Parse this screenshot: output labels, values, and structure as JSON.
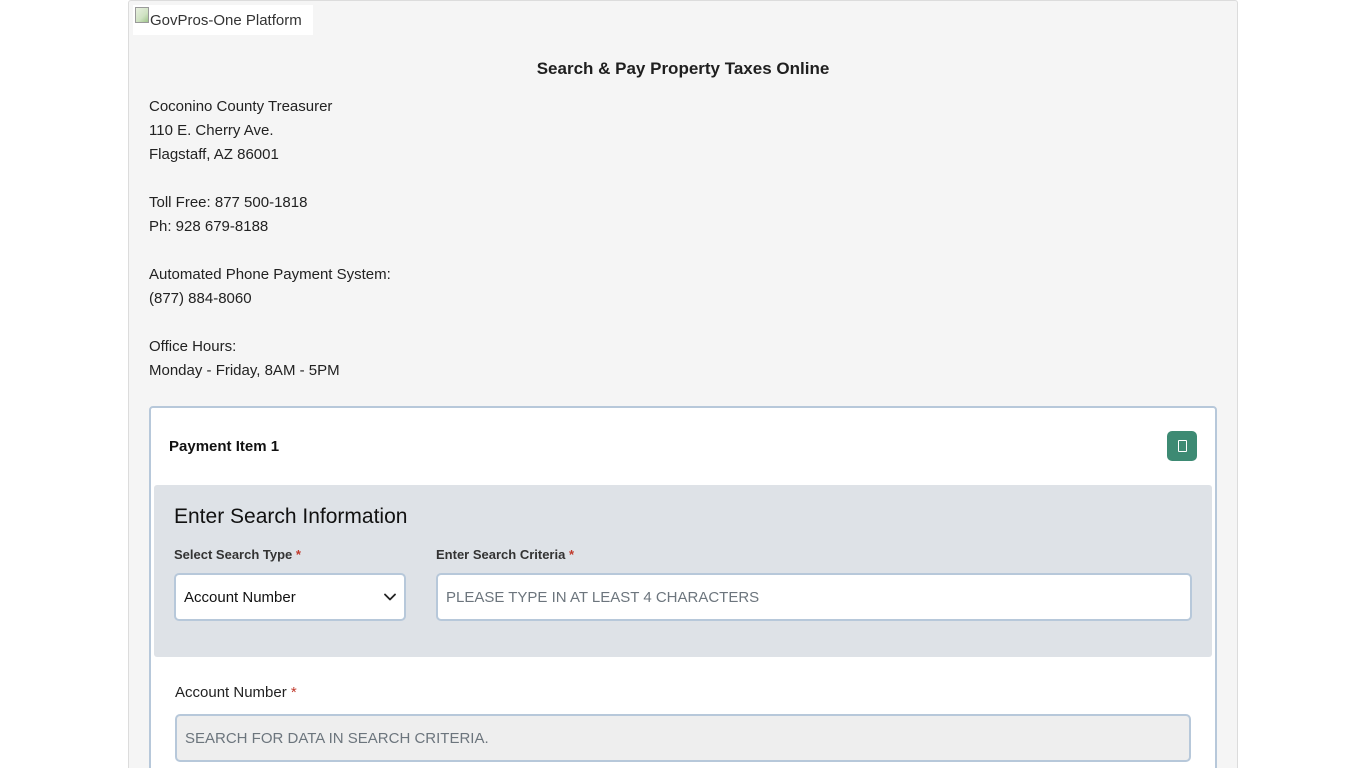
{
  "header": {
    "logo_alt": "GovPros-One Platform"
  },
  "page_title": "Search & Pay Property Taxes Online",
  "office": {
    "name": "Coconino County Treasurer",
    "street": "110 E. Cherry Ave.",
    "city": "Flagstaff, AZ 86001",
    "toll_free": "Toll Free: 877 500-1818",
    "phone": "Ph: 928 679-8188",
    "automated_label": "Automated Phone Payment System:",
    "automated_phone": "(877) 884-8060",
    "hours_label": "Office Hours:",
    "hours": "Monday - Friday, 8AM - 5PM"
  },
  "payment_card": {
    "title": "Payment Item 1",
    "action_icon": "square-icon",
    "action_color": "#3d8a73",
    "search": {
      "heading": "Enter Search Information",
      "type_label": "Select Search Type",
      "type_value": "Account Number",
      "criteria_label": "Enter Search Criteria",
      "criteria_placeholder": "PLEASE TYPE IN AT LEAST 4 CHARACTERS",
      "required_mark": "*"
    },
    "account": {
      "label": "Account Number",
      "placeholder": "SEARCH FOR DATA IN SEARCH CRITERIA.",
      "required_mark": "*"
    }
  }
}
